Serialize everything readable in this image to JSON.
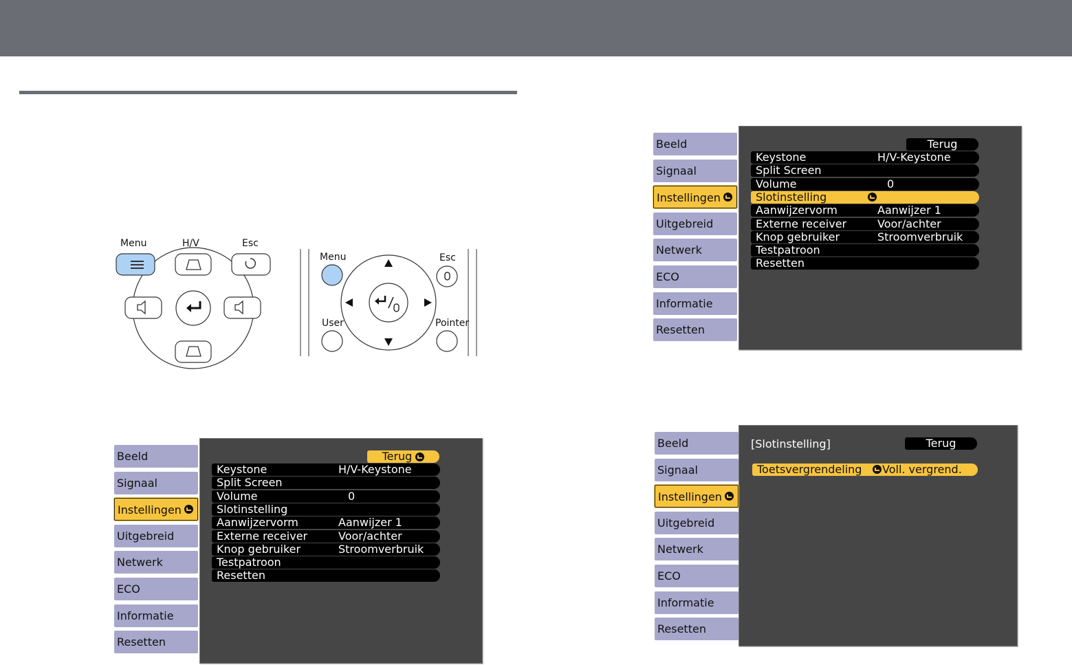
{
  "tabs": [
    "Beeld",
    "Signaal",
    "Instellingen",
    "Uitgebreid",
    "Netwerk",
    "ECO",
    "Informatie",
    "Resetten"
  ],
  "menu_rows": [
    {
      "label": "Keystone",
      "value": "H/V-Keystone"
    },
    {
      "label": "Split Screen",
      "value": ""
    },
    {
      "label": "Volume",
      "value": "0"
    },
    {
      "label": "Slotinstelling",
      "value": ""
    },
    {
      "label": "Aanwijzervorm",
      "value": "Aanwijzer 1"
    },
    {
      "label": "Externe receiver",
      "value": "Voor/achter"
    },
    {
      "label": "Knop gebruiker",
      "value": "Stroomverbruik"
    },
    {
      "label": "Testpatroon",
      "value": ""
    },
    {
      "label": "Resetten",
      "value": ""
    }
  ],
  "back_label": "Terug",
  "sub": {
    "title": "[Slotinstelling]",
    "row_label": "Toetsvergrendeling",
    "row_value": "Voll. vergrend."
  },
  "control_panel": {
    "menu": "Menu",
    "hv": "H/V",
    "esc": "Esc"
  },
  "remote": {
    "menu": "Menu",
    "esc": "Esc",
    "user": "User",
    "pointer": "Pointer"
  }
}
